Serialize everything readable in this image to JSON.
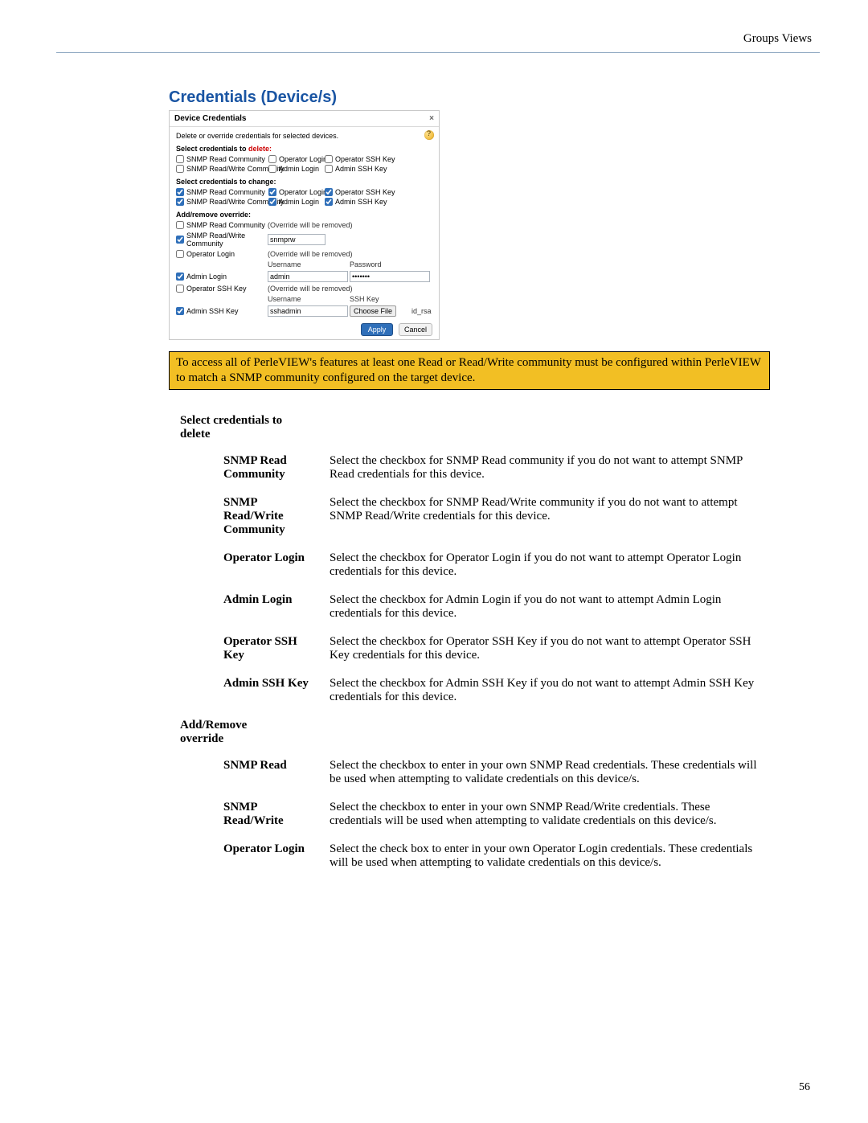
{
  "header": {
    "right": "Groups Views"
  },
  "section_title": "Credentials (Device/s)",
  "page_number": "56",
  "panel": {
    "title": "Device Credentials",
    "close": "×",
    "desc": "Delete or override credentials for selected devices.",
    "delete_head_pre": "Select credentials to ",
    "delete_head_red": "delete:",
    "change_head": "Select credentials to change:",
    "override_head": "Add/remove override:",
    "labels": {
      "snmp_read": "SNMP Read Community",
      "snmp_rw": "SNMP Read/Write Community",
      "op_login": "Operator Login",
      "admin_login": "Admin Login",
      "op_ssh": "Operator SSH Key",
      "admin_ssh": "Admin SSH Key",
      "username": "Username",
      "password": "Password",
      "sshkey": "SSH Key",
      "choose": "Choose File",
      "file_name": "id_rsa",
      "removed": "(Override will be removed)"
    },
    "values": {
      "snmprw": "snmprw",
      "admin_user": "admin",
      "admin_pass": "•••••••",
      "ssh_user": "sshadmin"
    },
    "buttons": {
      "apply": "Apply",
      "cancel": "Cancel"
    }
  },
  "notebox": "To access all of PerleVIEW's features at least one Read or Read/Write community must be configured within PerleVIEW to match a SNMP community configured on the target device.",
  "defs": {
    "delete_heading": "Select credentials to delete",
    "override_heading": "Add/Remove override",
    "delete_items": [
      {
        "term": "SNMP Read Community",
        "body": "Select the checkbox for SNMP Read community if you do not want to attempt SNMP Read credentials for this device."
      },
      {
        "term": "SNMP Read/Write Community",
        "body": "Select the checkbox for SNMP Read/Write community if you do not want to attempt SNMP Read/Write credentials for this device."
      },
      {
        "term": "Operator Login",
        "body": "Select the checkbox for Operator Login if you do not want to attempt Operator Login credentials for this device."
      },
      {
        "term": "Admin Login",
        "body": "Select the checkbox for Admin Login if you do not want to attempt Admin Login credentials for this device."
      },
      {
        "term": "Operator SSH Key",
        "body": "Select the checkbox for Operator SSH Key if you do not want to attempt Operator SSH Key credentials for this device."
      },
      {
        "term": "Admin SSH Key",
        "body": "Select the checkbox for Admin SSH Key if you do not want to attempt Admin SSH Key credentials for this device."
      }
    ],
    "override_items": [
      {
        "term": "SNMP Read",
        "body": "Select the checkbox to enter in your own SNMP Read credentials. These credentials will be used when attempting to validate credentials on this device/s."
      },
      {
        "term": "SNMP Read/Write",
        "body": "Select the checkbox to enter in your own SNMP Read/Write credentials. These credentials will be used when attempting to validate credentials on this device/s."
      },
      {
        "term": "Operator Login",
        "body": "Select the check box to enter in your own Operator Login credentials. These credentials will be used when attempting to validate credentials on this device/s."
      }
    ]
  }
}
